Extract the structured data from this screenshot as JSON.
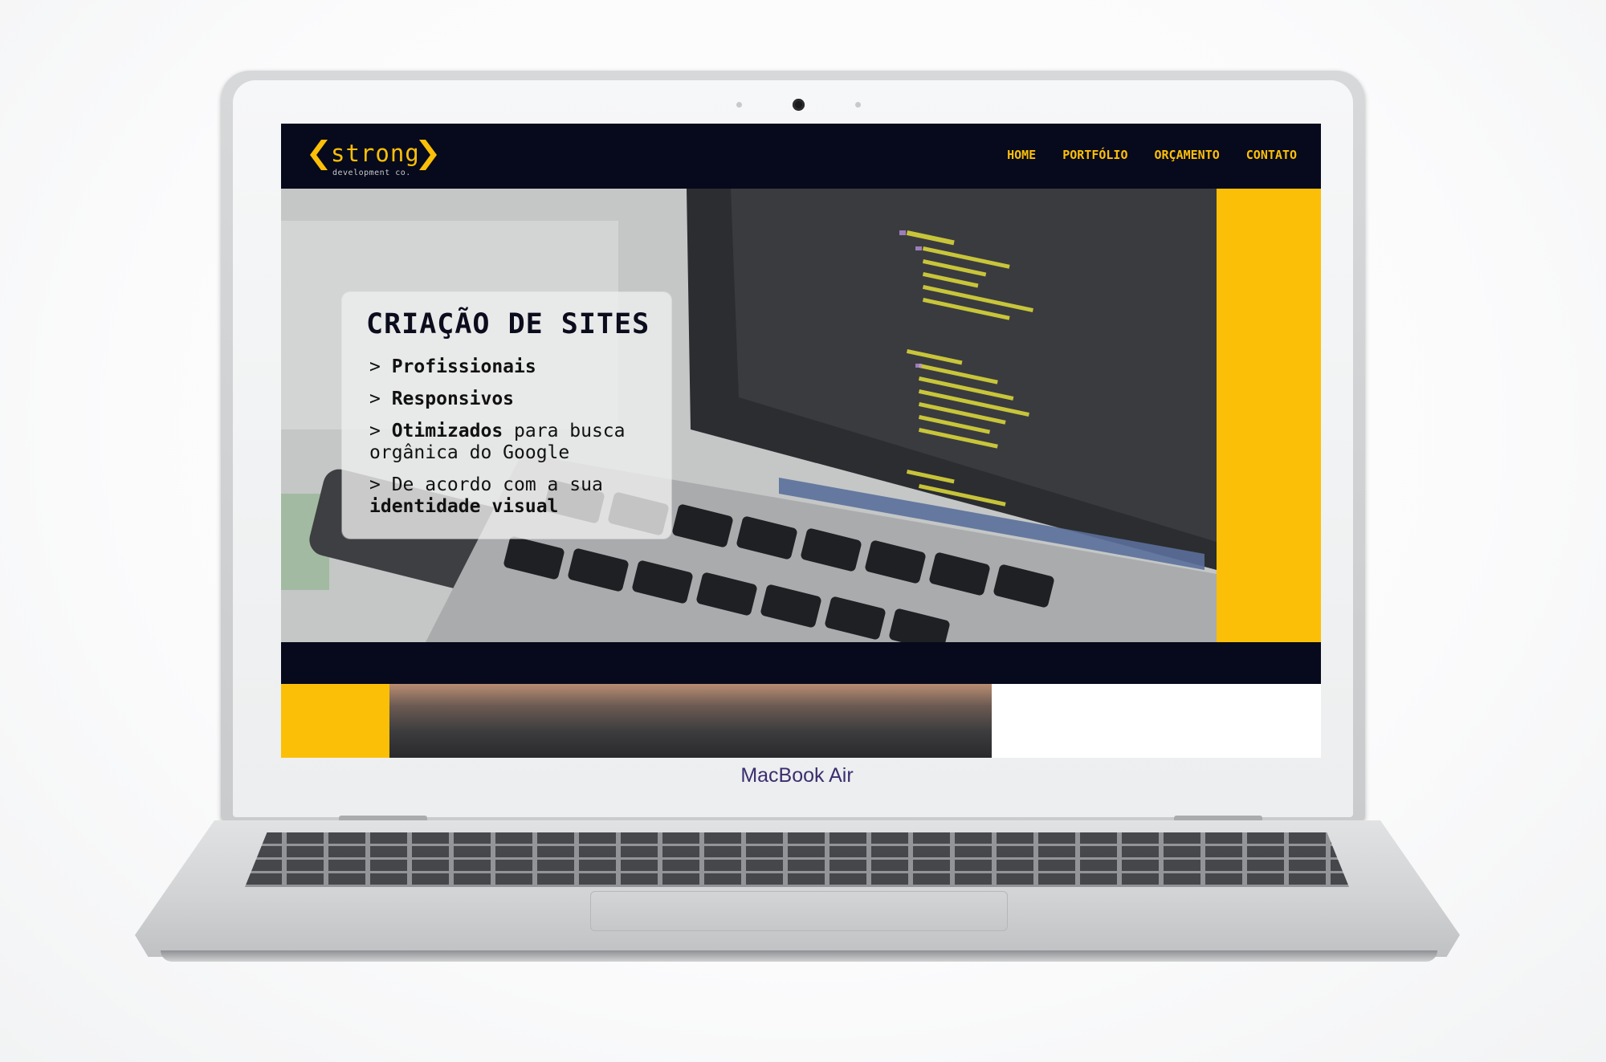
{
  "brand_label": "MacBook Air",
  "site": {
    "logo": {
      "name": "strong",
      "tagline": "development co."
    },
    "nav": [
      {
        "label": "HOME"
      },
      {
        "label": "PORTFÓLIO"
      },
      {
        "label": "ORÇAMENTO"
      },
      {
        "label": "CONTATO"
      }
    ],
    "hero": {
      "title": "CRIAÇÃO DE SITES",
      "bullets": [
        {
          "prefix": "> ",
          "bold": "Profissionais",
          "rest": ""
        },
        {
          "prefix": "> ",
          "bold": "Responsivos",
          "rest": ""
        },
        {
          "prefix": "> ",
          "bold": "Otimizados",
          "rest": " para busca orgânica do Google"
        },
        {
          "prefix": "> De acordo com a sua ",
          "bold": "identidade visual",
          "rest": ""
        }
      ]
    },
    "colors": {
      "accent": "#fcbf08",
      "dark": "#070a1c",
      "panel": "#eeeeee"
    }
  }
}
